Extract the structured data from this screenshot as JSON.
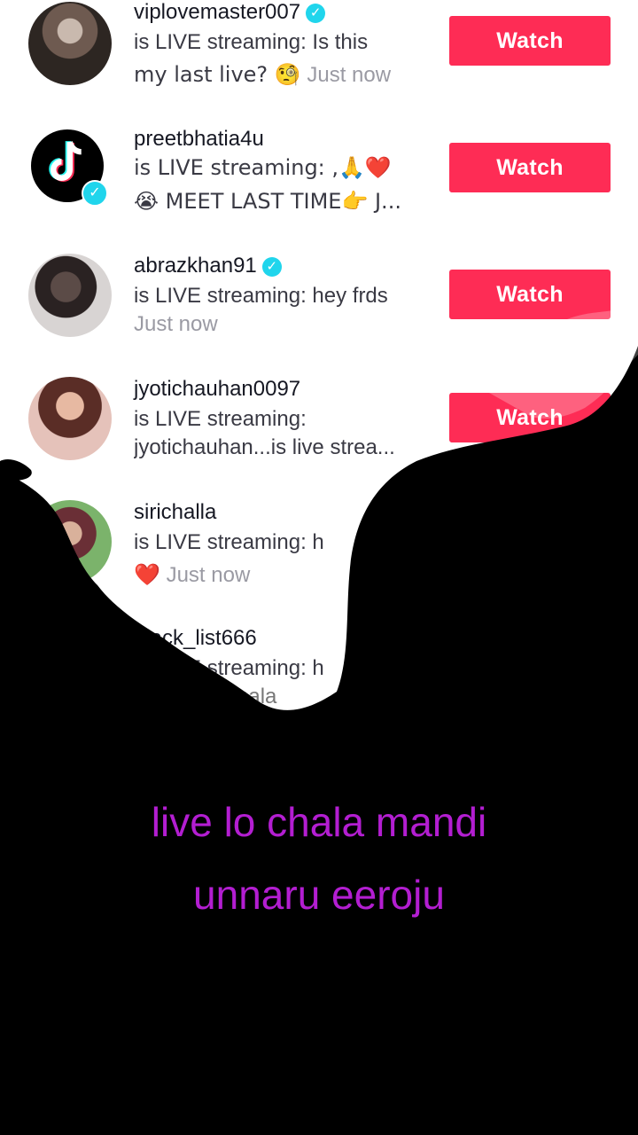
{
  "watch_label": "Watch",
  "accent_color": "#fe2c55",
  "verified_color": "#20d5ec",
  "caption_color": "#b31ed1",
  "rows": [
    {
      "username": "viplovemaster007",
      "verified": true,
      "line1": "is LIVE streaming: Is this",
      "line2_text": "my last live? 🧐",
      "line2_time": "Just now"
    },
    {
      "username": "preetbhatia4u",
      "verified": true,
      "line1": "is LIVE streaming: ,🙏❤️",
      "line2_text": "😭 MEET LAST TIME👉 J..."
    },
    {
      "username": "abrazkhan91",
      "verified": true,
      "line1": "is LIVE streaming: hey frds",
      "line2_time": "Just now"
    },
    {
      "username": "jyotichauhan0097",
      "verified": false,
      "line1": "is LIVE streaming:",
      "line2_text": "jyotichauhan...is live strea..."
    },
    {
      "username": "sirichalla",
      "verified": false,
      "line1": "is LIVE streaming: h",
      "line2_text": "❤️",
      "line2_time": "Just now"
    },
    {
      "username": "black_list666",
      "verified": false,
      "line1": "is LIVE streaming: h",
      "line2_text": "nchazzz ( mala"
    }
  ],
  "caption": {
    "line1": "live lo chala mandi",
    "line2": "unnaru eeroju"
  }
}
